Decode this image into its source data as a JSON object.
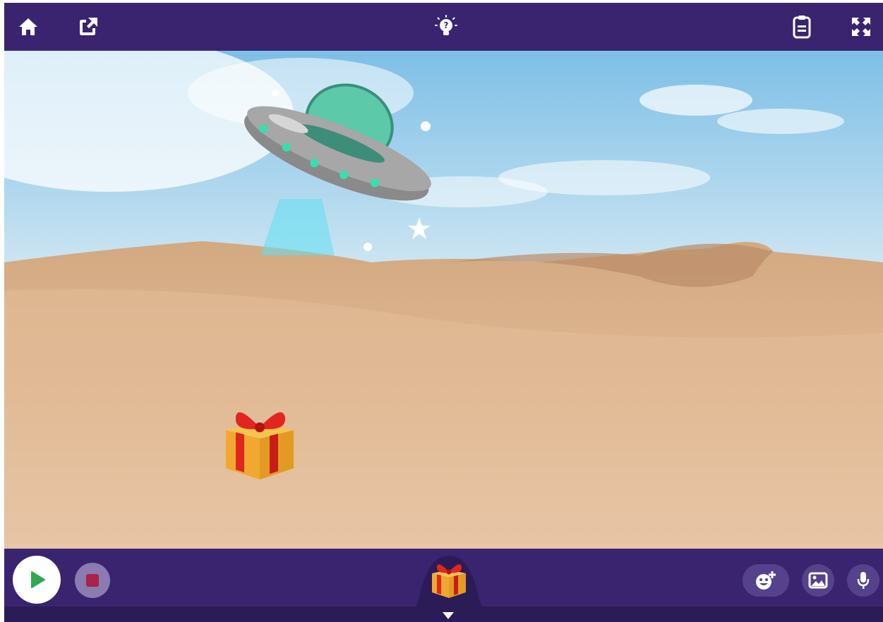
{
  "toolbar": {
    "home_icon": "home-icon",
    "share_icon": "share-icon",
    "hint_icon": "lightbulb-question-icon",
    "notes_icon": "clipboard-icon",
    "fullscreen_icon": "fullscreen-icon",
    "color": "#3a2470"
  },
  "stage": {
    "background": "desert-dunes-sky",
    "sprites": [
      "ufo",
      "gift-box"
    ]
  },
  "bottombar": {
    "go_icon": "play-icon",
    "stop_icon": "stop-icon",
    "selected_sprite_icon": "gift-box-icon",
    "add_sprite_icon": "add-character-icon",
    "add_background_icon": "image-icon",
    "record_icon": "microphone-icon",
    "colors": {
      "go": "#2fa84f",
      "stop": "#a8244a",
      "panel": "#3a2470"
    }
  }
}
